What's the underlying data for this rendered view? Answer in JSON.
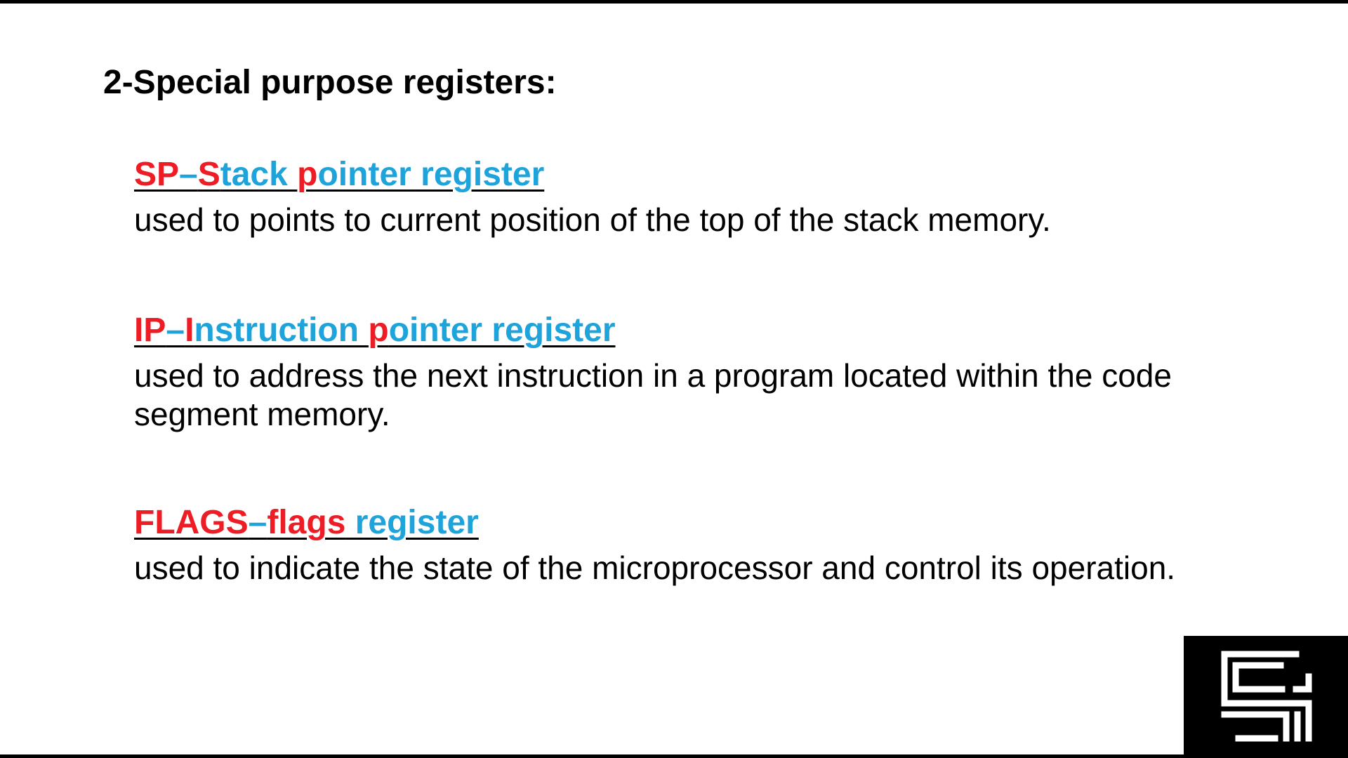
{
  "slide": {
    "title": "2-Special purpose registers:",
    "registers": [
      {
        "term_parts": [
          {
            "text": "SP",
            "color": "red"
          },
          {
            "text": "–",
            "color": "blue"
          },
          {
            "text": "S",
            "color": "red"
          },
          {
            "text": "tack ",
            "color": "blue"
          },
          {
            "text": "p",
            "color": "red"
          },
          {
            "text": "ointer register",
            "color": "blue"
          }
        ],
        "description": "used to points to current position of the top of the stack memory."
      },
      {
        "term_parts": [
          {
            "text": "IP",
            "color": "red"
          },
          {
            "text": "–",
            "color": "blue"
          },
          {
            "text": "I",
            "color": "red"
          },
          {
            "text": "nstruction ",
            "color": "blue"
          },
          {
            "text": "p",
            "color": "red"
          },
          {
            "text": "ointer register",
            "color": "blue"
          }
        ],
        "description": "used to address the next instruction in a program located within the code segment memory."
      },
      {
        "term_parts": [
          {
            "text": "FLAGS",
            "color": "red"
          },
          {
            "text": "–",
            "color": "blue"
          },
          {
            "text": "flags",
            "color": "red"
          },
          {
            "text": " register",
            "color": "blue"
          }
        ],
        "description": "used to indicate the state of the microprocessor and control its operation."
      }
    ]
  },
  "colors": {
    "red": "#ee1c25",
    "blue": "#1fa3db",
    "text": "#000000",
    "logo_background": "#000000"
  },
  "icons": {
    "logo": "maze-logo-icon"
  }
}
